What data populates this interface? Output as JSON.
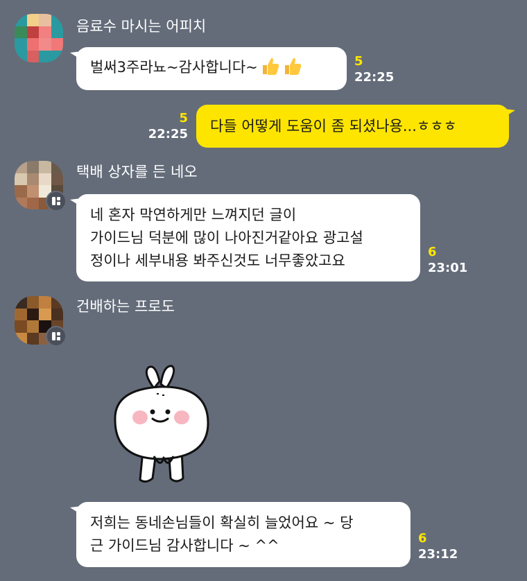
{
  "messages": [
    {
      "sender": "음료수 마시는 어피치",
      "lines": [
        "벌써3주라뇨~감사합니다~"
      ],
      "emoji": "thumbs-up-icon",
      "unread": "5",
      "time": "22:25"
    },
    {
      "mine": true,
      "lines": [
        "다들 어떻게 도움이 좀 되셨나용...ㅎㅎㅎ"
      ],
      "unread": "5",
      "time": "22:25"
    },
    {
      "sender": "택배 상자를 든 네오",
      "lines": [
        "네 혼자 막연하게만 느껴지던 글이",
        "가이드님 덕분에 많이 나아진거같아요 광고설",
        "정이나 세부내용 봐주신것도 너무좋았고요"
      ],
      "unread": "6",
      "time": "23:01"
    },
    {
      "sender": "건배하는 프로도",
      "sticker": "bunny-sticker",
      "lines": [
        "저희는 동네손님들이 확실히 늘었어요  ~ 당",
        "근 가이드님 감사합니다 ~ ^^"
      ],
      "unread": "6",
      "time": "23:12"
    }
  ],
  "colors": {
    "background": "#646c7a",
    "my_bubble": "#fee500",
    "other_bubble": "#ffffff",
    "unread": "#fee500"
  }
}
